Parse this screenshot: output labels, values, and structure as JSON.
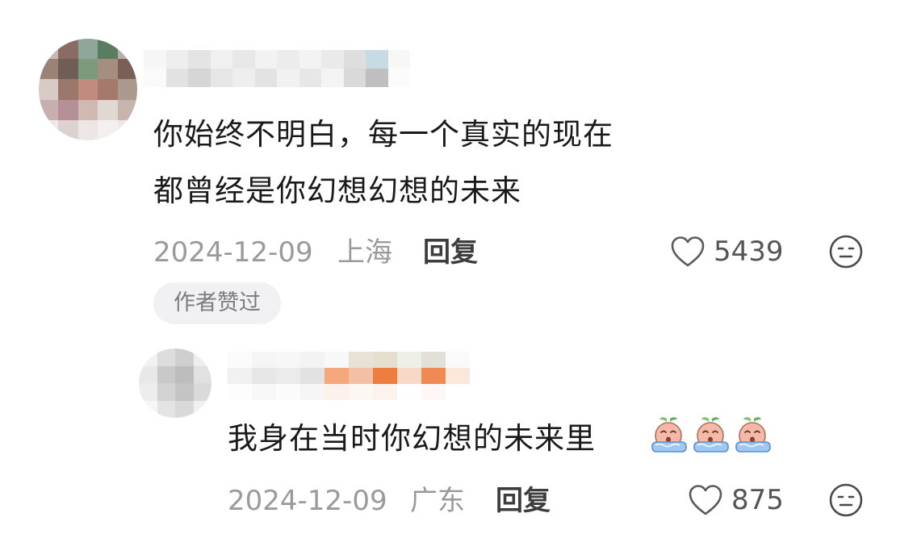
{
  "comments": [
    {
      "text_lines": [
        "你始终不明白，每一个真实的现在",
        "都曾经是你幻想幻想的未来"
      ],
      "date": "2024-12-09",
      "location": "上海",
      "reply_label": "回复",
      "like_count": "5439",
      "badge": "作者赞过"
    },
    {
      "text": "我身在当时你幻想的未来里",
      "emoji_icons": [
        "crying-peach-emoji",
        "crying-peach-emoji",
        "crying-peach-emoji"
      ],
      "date": "2024-12-09",
      "location": "广东",
      "reply_label": "回复",
      "like_count": "875"
    }
  ],
  "icons": {
    "like": "heart-outline-icon",
    "dislike": "meh-face-icon"
  },
  "colors": {
    "text": "#1a1a1a",
    "meta": "#9a9a9a",
    "badge_bg": "#f1f1f3"
  }
}
